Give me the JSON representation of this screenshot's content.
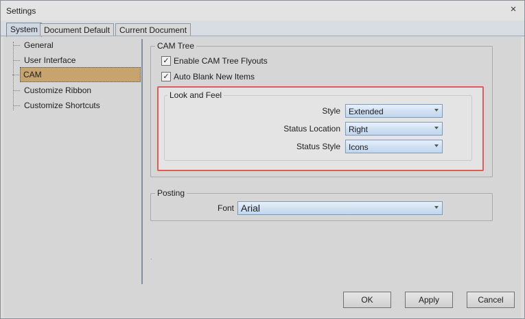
{
  "window": {
    "title": "Settings",
    "close_symbol": "×"
  },
  "tabs": [
    {
      "label": "System",
      "active": true
    },
    {
      "label": "Document Default",
      "active": false
    },
    {
      "label": "Current Document",
      "active": false
    }
  ],
  "tree": {
    "items": [
      {
        "label": "General",
        "selected": false
      },
      {
        "label": "User Interface",
        "selected": false
      },
      {
        "label": "CAM",
        "selected": true
      },
      {
        "label": "Customize Ribbon",
        "selected": false
      },
      {
        "label": "Customize Shortcuts",
        "selected": false
      }
    ]
  },
  "cam_tree": {
    "legend": "CAM Tree",
    "enable_flyouts": {
      "label": "Enable CAM Tree Flyouts",
      "checked": true
    },
    "auto_blank": {
      "label": "Auto Blank New Items",
      "checked": true
    },
    "look_and_feel": {
      "legend": "Look and Feel",
      "style": {
        "label": "Style",
        "value": "Extended"
      },
      "status_location": {
        "label": "Status Location",
        "value": "Right"
      },
      "status_style": {
        "label": "Status Style",
        "value": "Icons"
      }
    }
  },
  "posting": {
    "legend": "Posting",
    "font": {
      "label": "Font",
      "value": "Arial"
    }
  },
  "buttons": {
    "ok": "OK",
    "apply": "Apply",
    "cancel": "Cancel"
  },
  "colors": {
    "selection": "#c7a36e",
    "highlight_border": "#e05a5a",
    "combo_border": "#7a9ab8"
  },
  "check_mark": "✓"
}
